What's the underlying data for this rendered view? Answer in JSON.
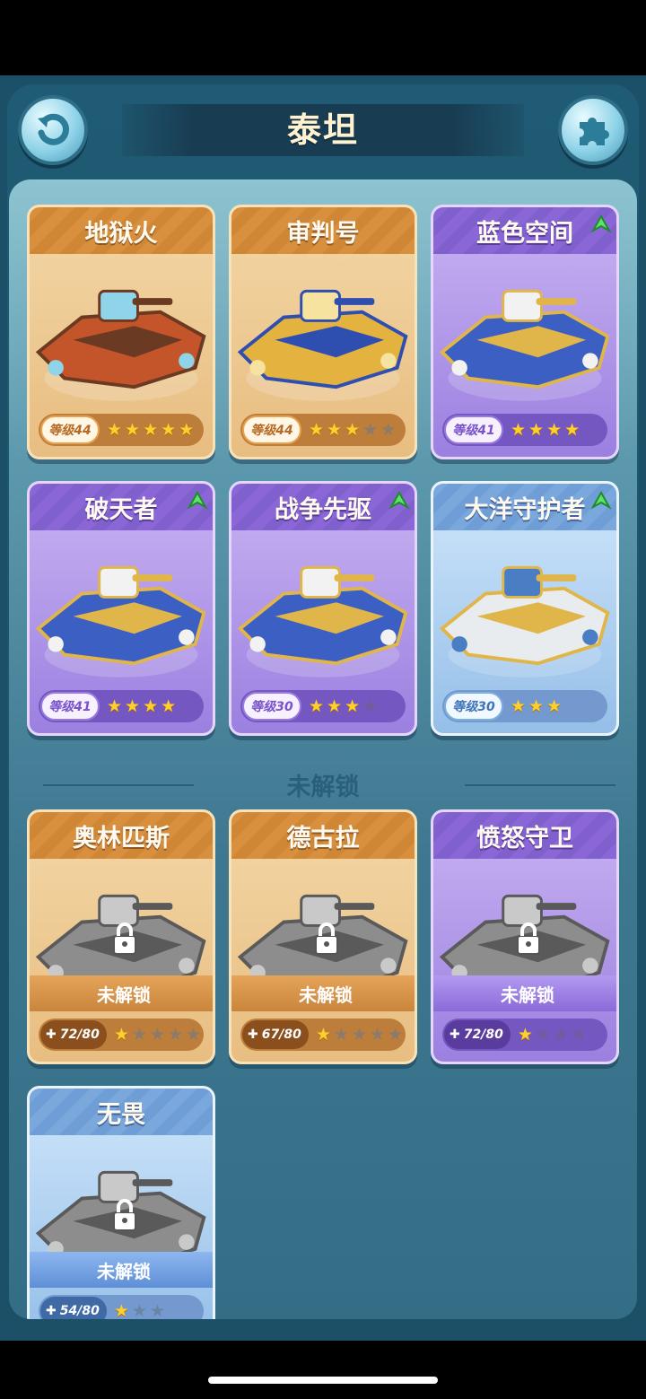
{
  "header": {
    "title": "泰坦",
    "back_icon": "refresh-arrow-icon",
    "puzzle_icon": "puzzle-piece-icon"
  },
  "unlocked_ships": [
    {
      "name": "地狱火",
      "rarity": "orange",
      "level": "等级44",
      "stars_on": 5,
      "stars_total": 5,
      "upgrade": false
    },
    {
      "name": "审判号",
      "rarity": "orange",
      "level": "等级44",
      "stars_on": 3,
      "stars_total": 5,
      "upgrade": false
    },
    {
      "name": "蓝色空间",
      "rarity": "purple",
      "level": "等级41",
      "stars_on": 4,
      "stars_total": 4,
      "upgrade": true
    },
    {
      "name": "破天者",
      "rarity": "purple",
      "level": "等级41",
      "stars_on": 4,
      "stars_total": 4,
      "upgrade": true
    },
    {
      "name": "战争先驱",
      "rarity": "purple",
      "level": "等级30",
      "stars_on": 3,
      "stars_total": 4,
      "upgrade": true
    },
    {
      "name": "大洋守护者",
      "rarity": "blue",
      "level": "等级30",
      "stars_on": 3,
      "stars_total": 3,
      "upgrade": true
    }
  ],
  "section": {
    "locked_title": "未解锁"
  },
  "locked_ships": [
    {
      "name": "奥林匹斯",
      "rarity": "orange",
      "lock_label": "未解锁",
      "fragments": "72/80",
      "stars_on": 1,
      "stars_total": 5
    },
    {
      "name": "德古拉",
      "rarity": "orange",
      "lock_label": "未解锁",
      "fragments": "67/80",
      "stars_on": 1,
      "stars_total": 5
    },
    {
      "name": "愤怒守卫",
      "rarity": "purple",
      "lock_label": "未解锁",
      "fragments": "72/80",
      "stars_on": 1,
      "stars_total": 4
    },
    {
      "name": "无畏",
      "rarity": "blue",
      "lock_label": "未解锁",
      "fragments": "54/80",
      "stars_on": 1,
      "stars_total": 3
    }
  ],
  "colors": {
    "orange_card": "#e8bd81",
    "purple_card": "#9b80e0",
    "blue_card": "#95bfe8",
    "star_on": "#ffcf2e",
    "background": "#1c4f68"
  }
}
